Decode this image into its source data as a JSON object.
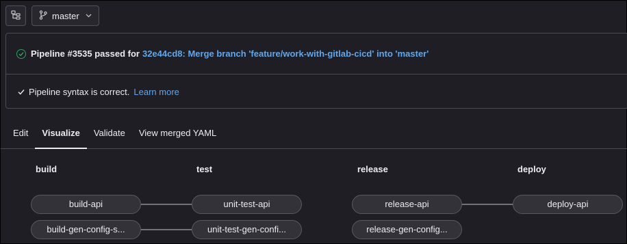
{
  "toolbar": {
    "tree_icon": "file-tree-icon",
    "branch_icon": "branch-icon",
    "branch_name": "master",
    "dropdown_icon": "chevron-down-icon"
  },
  "pipeline_status": {
    "status_icon": "status-success-icon",
    "label": "Pipeline #3535 passed for",
    "commit_link": "32e44cd8: Merge branch 'feature/work-with-gitlab-cicd' into 'master'",
    "color_success": "#2da160",
    "color_link": "#63a6e9"
  },
  "lint": {
    "check_icon": "check-icon",
    "message": "Pipeline syntax is correct.",
    "learn_more": "Learn more"
  },
  "tabs": [
    {
      "label": "Edit",
      "active": false
    },
    {
      "label": "Visualize",
      "active": true
    },
    {
      "label": "Validate",
      "active": false
    },
    {
      "label": "View merged YAML",
      "active": false
    }
  ],
  "stages": [
    {
      "name": "build",
      "jobs": [
        "build-api",
        "build-gen-config-s..."
      ]
    },
    {
      "name": "test",
      "jobs": [
        "unit-test-api",
        "unit-test-gen-confi..."
      ]
    },
    {
      "name": "release",
      "jobs": [
        "release-api",
        "release-gen-config..."
      ]
    },
    {
      "name": "deploy",
      "jobs": [
        "deploy-api"
      ]
    }
  ]
}
